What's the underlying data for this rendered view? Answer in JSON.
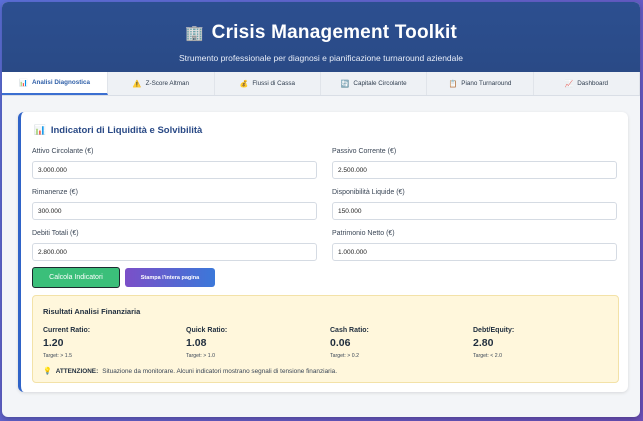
{
  "header": {
    "icon": "building-icon",
    "title": "Crisis Management Toolkit",
    "subtitle": "Strumento professionale per diagnosi e pianificazione turnaround aziendale"
  },
  "tabs": [
    {
      "icon": "chart-icon",
      "label": "Analisi Diagnostica",
      "active": true
    },
    {
      "icon": "warning-icon",
      "label": "Z-Score Altman",
      "active": false
    },
    {
      "icon": "money-icon",
      "label": "Flussi di Cassa",
      "active": false
    },
    {
      "icon": "card-icon",
      "label": "Capitale Circolante",
      "active": false
    },
    {
      "icon": "clipboard-icon",
      "label": "Piano Turnaround",
      "active": false
    },
    {
      "icon": "dashboard-icon",
      "label": "Dashboard",
      "active": false
    }
  ],
  "section": {
    "title": "Indicatori di Liquidità e Solvibilità",
    "fields": {
      "attivo_circolante": {
        "label": "Attivo Circolante (€)",
        "value": "3.000.000"
      },
      "passivo_corrente": {
        "label": "Passivo Corrente (€)",
        "value": "2.500.000"
      },
      "rimanenze": {
        "label": "Rimanenze (€)",
        "value": "300.000"
      },
      "disponibilita_liquide": {
        "label": "Disponibilità Liquide (€)",
        "value": "150.000"
      },
      "debiti_totali": {
        "label": "Debiti Totali (€)",
        "value": "2.800.000"
      },
      "patrimonio_netto": {
        "label": "Patrimonio Netto (€)",
        "value": "1.000.000"
      }
    },
    "buttons": {
      "calc": "Calcola Indicatori",
      "print": "Stampa l'intera pagina"
    }
  },
  "results": {
    "title": "Risultati Analisi Finanziaria",
    "metrics": [
      {
        "label": "Current Ratio:",
        "value": "1.20",
        "target": "Target: > 1.5"
      },
      {
        "label": "Quick Ratio:",
        "value": "1.08",
        "target": "Target: > 1.0"
      },
      {
        "label": "Cash Ratio:",
        "value": "0.06",
        "target": "Target: > 0.2"
      },
      {
        "label": "Debt/Equity:",
        "value": "2.80",
        "target": "Target: < 2.0"
      }
    ],
    "alert_label": "ATTENZIONE:",
    "alert_text": "Situazione da monitorare. Alcuni indicatori mostrano segnali di tensione finanziaria."
  }
}
